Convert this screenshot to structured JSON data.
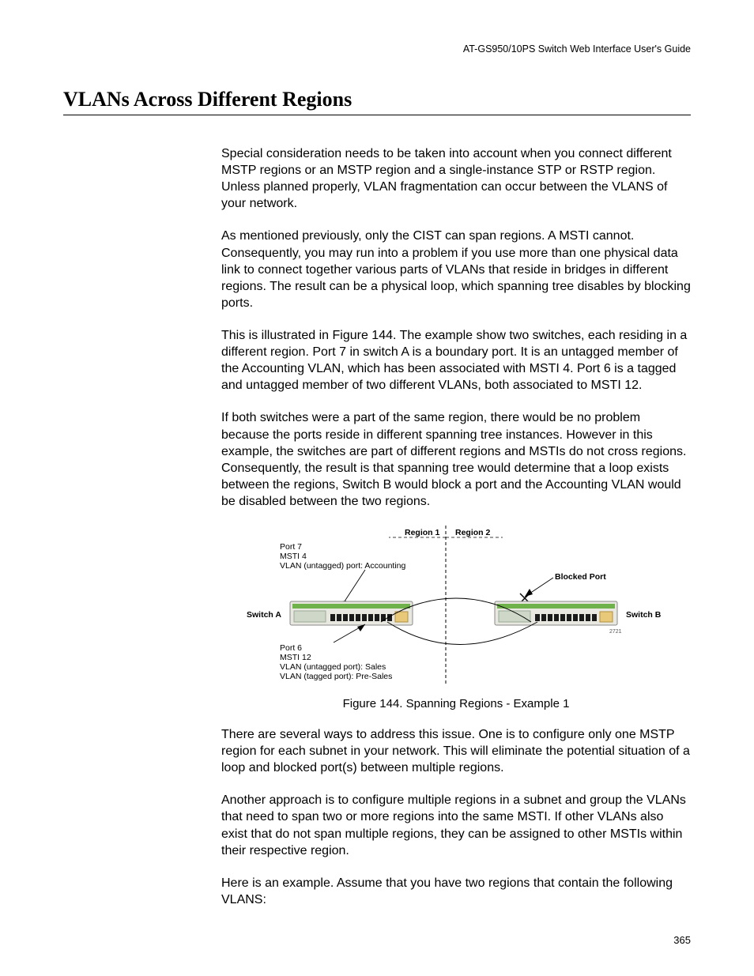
{
  "header": {
    "running": "AT-GS950/10PS Switch Web Interface User's Guide"
  },
  "section": {
    "title": "VLANs Across Different Regions"
  },
  "paragraphs": {
    "p1": "Special consideration needs to be taken into account when you connect different MSTP regions or an MSTP region and a single-instance STP or RSTP region. Unless planned properly, VLAN fragmentation can occur between the VLANS of your network.",
    "p2": "As mentioned previously, only the CIST can span regions. A MSTI cannot. Consequently, you may run into a problem if you use more than one physical data link to connect together various parts of VLANs that reside in bridges in different regions. The result can be a physical loop, which spanning tree disables by blocking ports.",
    "p3": "This is illustrated in Figure 144. The example show two switches, each residing in a different region. Port 7 in switch A is a boundary port. It is an untagged member of the Accounting VLAN, which has been associated with MSTI 4. Port 6 is a tagged and untagged member of two different VLANs, both associated to MSTI 12.",
    "p4": "If both switches were a part of the same region, there would be no problem because the ports reside in different spanning tree instances. However in this example, the switches are part of different regions and MSTIs do not cross regions. Consequently, the result is that spanning tree would determine that a loop exists between the regions, Switch B would block a port and the Accounting VLAN would be disabled between the two regions.",
    "p5": "There are several ways to address this issue. One is to configure only one MSTP region for each subnet in your network. This will eliminate the potential situation of a loop and blocked port(s) between multiple regions.",
    "p6": "Another approach is to configure multiple regions in a subnet and group the VLANs that need to span two or more regions into the same MSTI. If other VLANs also exist that do not span multiple regions, they can be assigned to other MSTIs within their respective region.",
    "p7": "Here is an example. Assume that you have two regions that contain the following VLANS:"
  },
  "figure": {
    "caption": "Figure 144. Spanning Regions - Example 1",
    "labels": {
      "region1": "Region 1",
      "region2": "Region 2",
      "switchA": "Switch A",
      "switchB": "Switch B",
      "blocked": "Blocked Port",
      "port7_l1": "Port 7",
      "port7_l2": "MSTI 4",
      "port7_l3": "VLAN (untagged) port: Accounting",
      "port6_l1": "Port 6",
      "port6_l2": "MSTI 12",
      "port6_l3": "VLAN (untagged port): Sales",
      "port6_l4": "VLAN (tagged port): Pre-Sales",
      "fineprint": "2721"
    }
  },
  "page_number": "365"
}
